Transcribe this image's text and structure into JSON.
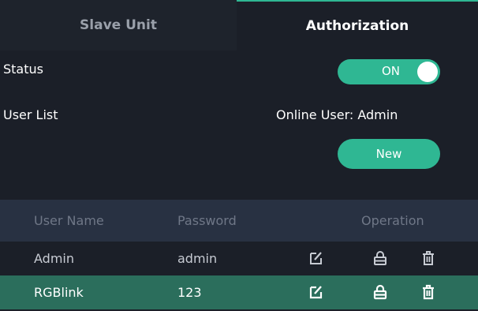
{
  "tabs": [
    {
      "label": "Slave Unit",
      "active": false
    },
    {
      "label": "Authorization",
      "active": true
    }
  ],
  "status": {
    "label": "Status",
    "toggle_text": "ON",
    "toggle_on": true
  },
  "user_list": {
    "label": "User List",
    "online_user": "Online User: Admin",
    "new_button": "New"
  },
  "table": {
    "columns": [
      "User Name",
      "Password",
      "Operation"
    ],
    "rows": [
      {
        "user": "Admin",
        "password": "admin",
        "selected": false
      },
      {
        "user": "RGBlink",
        "password": "123",
        "selected": true
      }
    ],
    "row_icons": [
      "edit-icon",
      "lock-icon",
      "trash-icon"
    ]
  },
  "colors": {
    "accent": "#2fb793",
    "background": "#1b1f28",
    "header": "#283142",
    "selected_row": "#2b6e5c"
  }
}
